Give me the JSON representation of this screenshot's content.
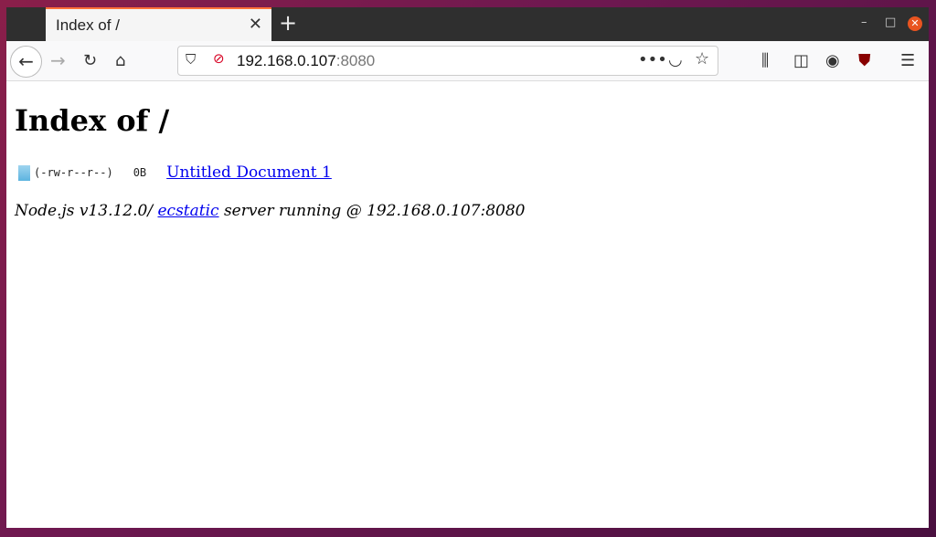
{
  "browser": {
    "tab_title": "Index of /",
    "url_host": "192.168.0.107",
    "url_port": ":8080"
  },
  "page": {
    "heading": "Index of /",
    "files": [
      {
        "perms": "(-rw-r--r--)",
        "size": "0B",
        "name": "Untitled Document 1"
      }
    ],
    "footer_prefix": "Node.js v13.12.0/ ",
    "footer_link": "ecstatic",
    "footer_suffix": " server running @ 192.168.0.107:8080"
  }
}
